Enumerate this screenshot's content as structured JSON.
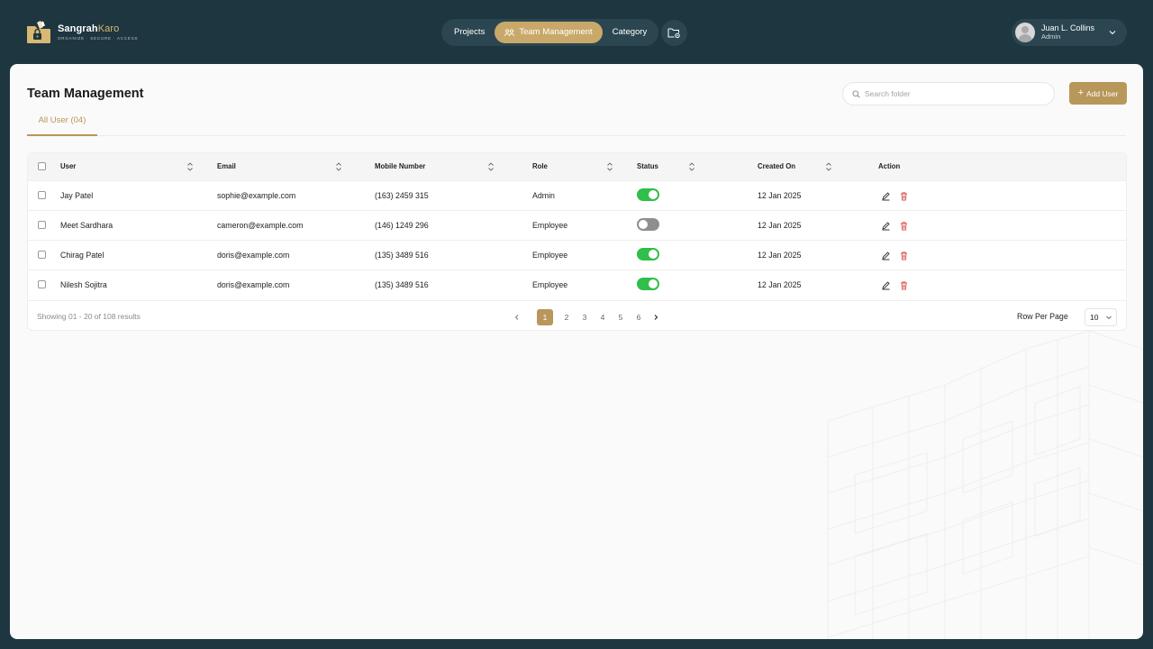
{
  "brand": {
    "name_primary": "Sangrah",
    "name_accent": "Karo",
    "tagline": "ORGANIZE · SECURE · ACCESS"
  },
  "nav": {
    "items": [
      {
        "label": "Projects",
        "active": false
      },
      {
        "label": "Team Management",
        "active": true
      },
      {
        "label": "Category",
        "active": false
      }
    ]
  },
  "user": {
    "name": "Juan L. Collins",
    "role": "Admin"
  },
  "page": {
    "title": "Team Management",
    "search_placeholder": "Search folder",
    "add_button_label": "Add User",
    "tab_label": "All User (04)"
  },
  "table": {
    "columns": [
      "User",
      "Email",
      "Mobile Number",
      "Role",
      "Status",
      "Created On",
      "Action"
    ],
    "rows": [
      {
        "user": "Jay Patel",
        "email": "sophie@example.com",
        "mobile": "(163) 2459 315",
        "role": "Admin",
        "status": true,
        "created": "12 Jan 2025"
      },
      {
        "user": "Meet Sardhara",
        "email": "cameron@example.com",
        "mobile": "(146) 1249 296",
        "role": "Employee",
        "status": false,
        "created": "12 Jan 2025"
      },
      {
        "user": "Chirag Patel",
        "email": "doris@example.com",
        "mobile": "(135) 3489 516",
        "role": "Employee",
        "status": true,
        "created": "12 Jan 2025"
      },
      {
        "user": "Nilesh Sojitra",
        "email": "doris@example.com",
        "mobile": "(135) 3489 516",
        "role": "Employee",
        "status": true,
        "created": "12 Jan 2025"
      }
    ]
  },
  "pagination": {
    "showing_text": "Showing 01 - 20 of 108 results",
    "pages": [
      "1",
      "2",
      "3",
      "4",
      "5",
      "6"
    ],
    "current_page": "1",
    "rows_per_page_label": "Row Per Page",
    "rows_per_page_value": "10"
  },
  "colors": {
    "frame": "#1d3640",
    "accent": "#b8975a",
    "nav_active": "#c8a96a",
    "toggle_on": "#2fbf4a",
    "toggle_off": "#8e8e8e",
    "delete": "#d9534f"
  }
}
